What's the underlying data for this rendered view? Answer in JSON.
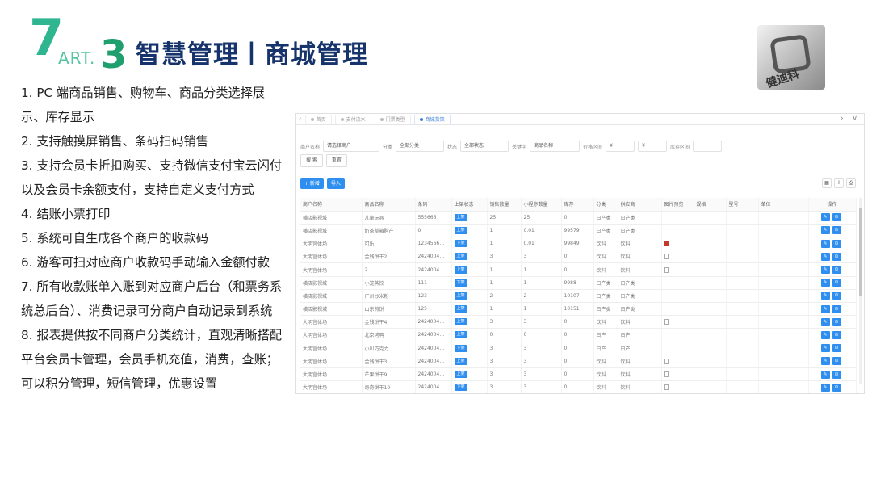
{
  "brand": {
    "seven": "7",
    "part": "ART",
    "dot": ".",
    "number": "3"
  },
  "title": "智慧管理丨商城管理",
  "logo_text": "健迪科",
  "features": [
    "1. PC 端商品销售、购物车、商品分类选择展示、库存显示",
    "2. 支持触摸屏销售、条码扫码销售",
    "3. 支持会员卡折扣购买、支持微信支付宝云闪付以及会员卡余额支付，支持自定义支付方式",
    "4. 结账小票打印",
    "5. 系统可自生成各个商户的收款码",
    "6. 游客可扫对应商户收款码手动输入金额付款",
    "7. 所有收款账单入账到对应商户后台（和票务系统总后台）、消费记录可分商户自动记录到系统",
    "8. 报表提供按不同商户分类统计，直观清晰搭配平台会员卡管理，会员手机充值，消费，查账；可以积分管理，短信管理，优惠设置"
  ],
  "screenshot": {
    "tabs": [
      "首页",
      "支付流水",
      "门票类型",
      "商城货架"
    ],
    "filters": [
      {
        "label": "商户名称",
        "value": "请选择商户"
      },
      {
        "label": "分类",
        "value": "全部分类"
      },
      {
        "label": "状态",
        "value": "全部状态"
      },
      {
        "label": "关键字",
        "value": "商品名称"
      },
      {
        "label": "价格区间",
        "value": "¥"
      },
      {
        "label": "",
        "value": "¥"
      },
      {
        "label": "库存区间",
        "value": ""
      }
    ],
    "filter_buttons": [
      "搜 索",
      "重置"
    ],
    "toolbar": {
      "add": "+ 新增",
      "import": "导入"
    },
    "columns": [
      "商户名称",
      "商品名称",
      "条码",
      "上架状态",
      "销售数量",
      "小程序数量",
      "库存",
      "分类",
      "供应商",
      "图片预览",
      "规格",
      "型号",
      "单位",
      "操作"
    ],
    "rows": [
      [
        "横店影视城",
        "儿童玩具",
        "555666",
        "上架",
        "25",
        "25",
        "0",
        "日产类",
        "日产类",
        "",
        "",
        "",
        ""
      ],
      [
        "横店影视城",
        "奶茶整箱购产",
        "0",
        "上架",
        "1",
        "0.01",
        "99579",
        "日产类",
        "日产类",
        "",
        "",
        "",
        ""
      ],
      [
        "大明宫体场",
        "可乐",
        "1234566…",
        "下架",
        "1",
        "0.01",
        "99849",
        "饮料",
        "饮料",
        "red",
        "",
        "",
        ""
      ],
      [
        "大明宫体场",
        "金钱饼干2",
        "2424004…",
        "上架",
        "3",
        "3",
        "0",
        "饮料",
        "饮料",
        "img",
        "",
        "",
        ""
      ],
      [
        "大明宫体场",
        "2",
        "2424004…",
        "上架",
        "1",
        "1",
        "0",
        "饮料",
        "饮料",
        "img",
        "",
        "",
        ""
      ],
      [
        "横店影视城",
        "小笼蒸饺",
        "111",
        "下架",
        "1",
        "1",
        "9988",
        "日产类",
        "日产类",
        "",
        "",
        "",
        ""
      ],
      [
        "横店影视城",
        "广州炒米粉",
        "123",
        "上架",
        "2",
        "2",
        "10107",
        "日产类",
        "日产类",
        "",
        "",
        "",
        ""
      ],
      [
        "横店影视城",
        "山东煎饼",
        "125",
        "上架",
        "1",
        "1",
        "10151",
        "日产类",
        "日产类",
        "",
        "",
        "",
        ""
      ],
      [
        "大明宫体场",
        "金钱饼干4",
        "2424004…",
        "上架",
        "3",
        "3",
        "0",
        "饮料",
        "饮料",
        "img",
        "",
        "",
        ""
      ],
      [
        "大明宫体场",
        "北京烤鸭",
        "2424004…",
        "上架",
        "0",
        "0",
        "0",
        "日产",
        "日产",
        "",
        "",
        "",
        ""
      ],
      [
        "大明宫体场",
        "小川巧克力",
        "2424004…",
        "下架",
        "3",
        "3",
        "0",
        "日产",
        "日产",
        "",
        "",
        "",
        ""
      ],
      [
        "大明宫体场",
        "金钱饼干3",
        "2424004…",
        "上架",
        "3",
        "3",
        "0",
        "饮料",
        "饮料",
        "img",
        "",
        "",
        ""
      ],
      [
        "大明宫体场",
        "芒果饼干9",
        "2424004…",
        "上架",
        "3",
        "3",
        "0",
        "饮料",
        "饮料",
        "img",
        "",
        "",
        ""
      ],
      [
        "大明宫体场",
        "奇奇饼干10",
        "2424004…",
        "下架",
        "3",
        "3",
        "0",
        "饮料",
        "饮料",
        "img",
        "",
        "",
        ""
      ]
    ]
  }
}
